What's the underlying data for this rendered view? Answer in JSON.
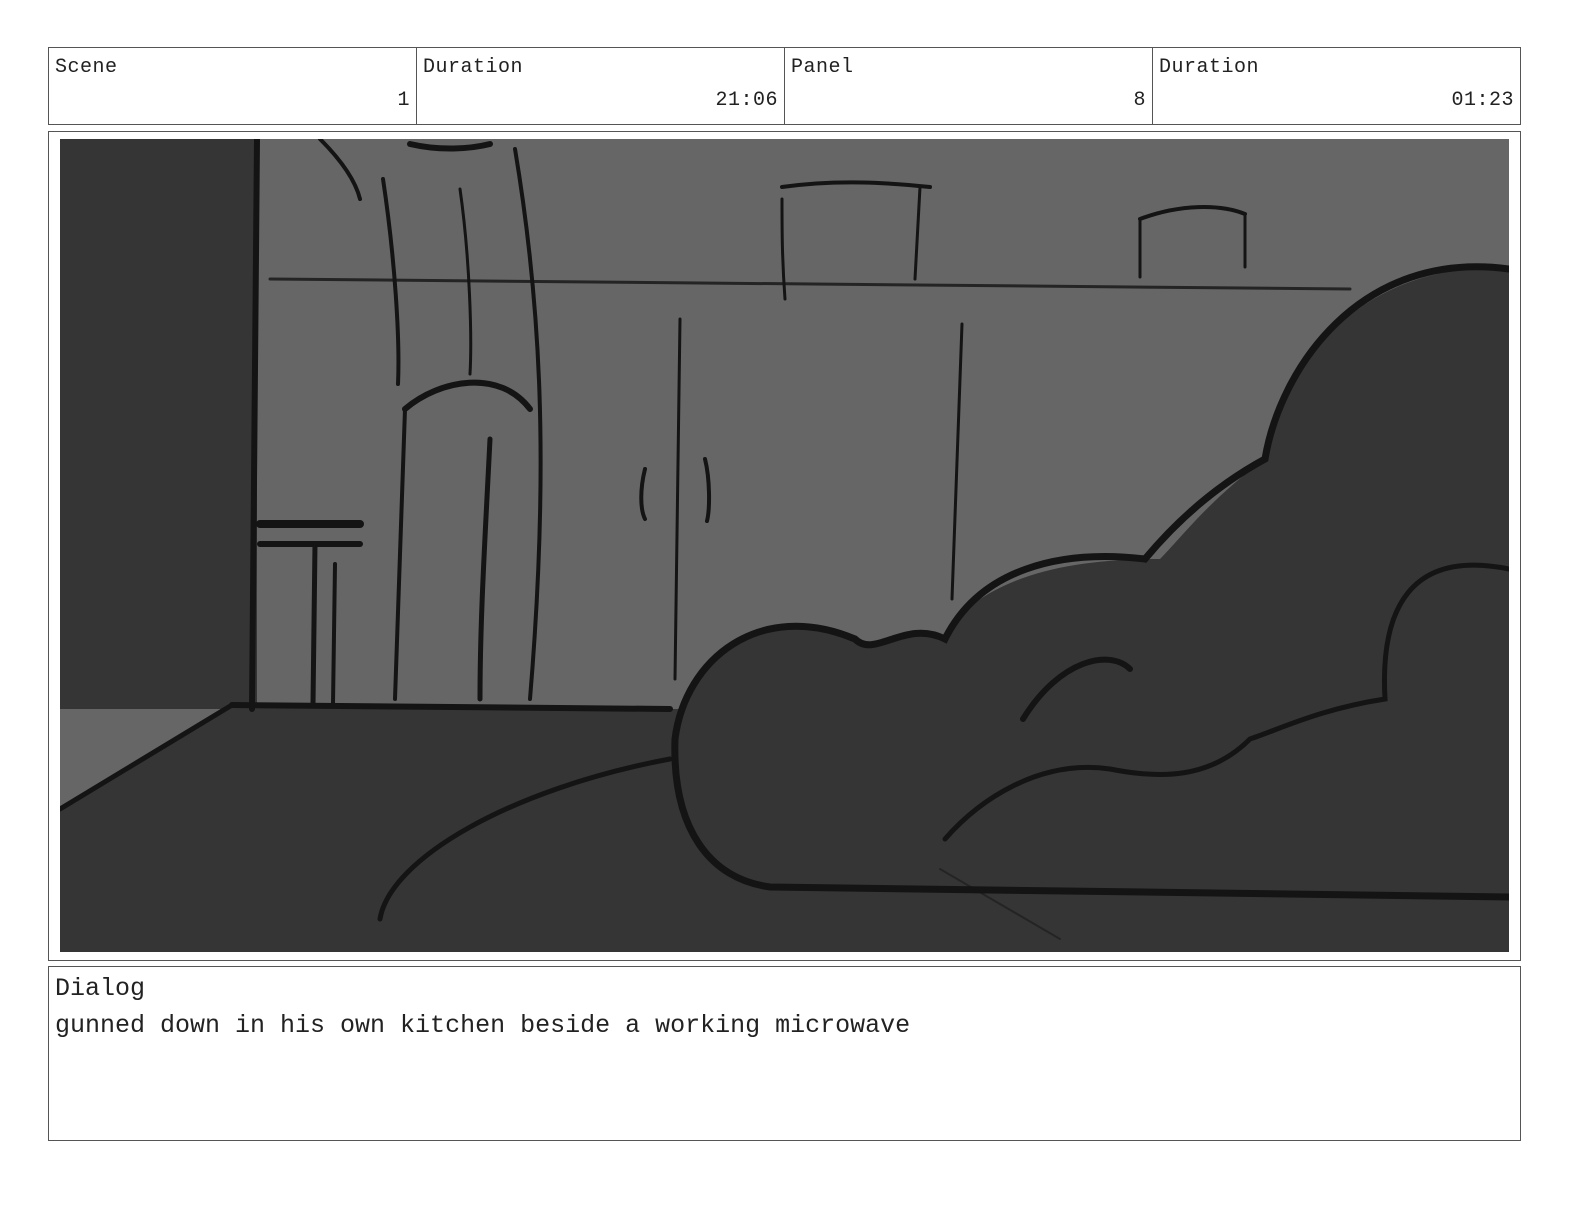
{
  "header": {
    "scene_label": "Scene",
    "scene_value": "1",
    "scene_duration_label": "Duration",
    "scene_duration_value": "21:06",
    "panel_label": "Panel",
    "panel_value": "8",
    "panel_duration_label": "Duration",
    "panel_duration_value": "01:23"
  },
  "panel_image": {
    "description_icon": "storyboard-sketch-icon",
    "colors": {
      "background": "#666666",
      "dark": "#353535",
      "ink": "#141414"
    }
  },
  "dialog": {
    "label": "Dialog",
    "text": "gunned down in his own kitchen beside a working microwave"
  }
}
